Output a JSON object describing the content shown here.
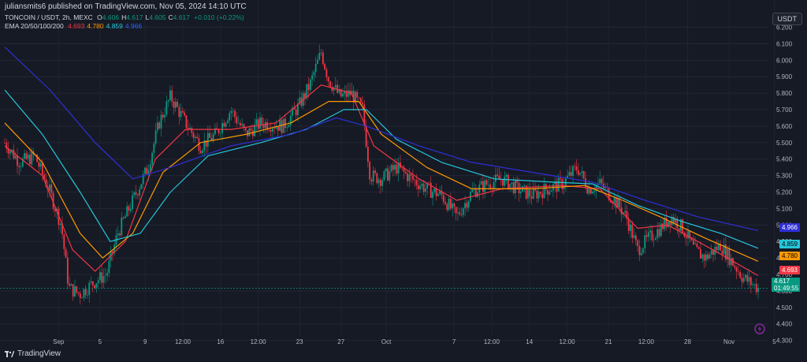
{
  "header": {
    "publish_line": "juliansmits6 published on TradingView.com, Nov 05, 2024 14:10 UTC"
  },
  "legend": {
    "symbol_text": "TONCOIN / USDT, 2h, MEXC",
    "ohlc": [
      {
        "k": "O",
        "v": "4.606"
      },
      {
        "k": "H",
        "v": "4.617"
      },
      {
        "k": "L",
        "v": "4.605"
      },
      {
        "k": "C",
        "v": "4.617"
      }
    ],
    "change": "+0.010 (+0.22%)",
    "ema_label": "EMA 20/50/100/200",
    "ema_values": [
      {
        "v": "4.693",
        "color": "#f23645"
      },
      {
        "v": "4.780",
        "color": "#ff9800"
      },
      {
        "v": "4.859",
        "color": "#26c6da"
      },
      {
        "v": "4.966",
        "color": "#2962ff"
      }
    ]
  },
  "quote_currency": "USDT",
  "price_tags": {
    "ema200": {
      "text": "4.966",
      "color": "#2f2fd4"
    },
    "ema100": {
      "text": "4.859",
      "color": "#26c6da"
    },
    "ema50": {
      "text": "4.780",
      "color": "#ff9800"
    },
    "ema20": {
      "text": "4.693",
      "color": "#f23645"
    },
    "last": {
      "text": "4.617",
      "color": "#089981"
    },
    "countdown": "01:49:55"
  },
  "brand": "TradingView",
  "chart_data": {
    "type": "candlestick",
    "ylim": [
      4.26,
      6.26
    ],
    "y_ticks": [
      "6.200",
      "6.100",
      "6.000",
      "5.900",
      "5.800",
      "5.700",
      "5.600",
      "5.500",
      "5.400",
      "5.300",
      "5.200",
      "5.100",
      "5.000",
      "4.900",
      "4.800",
      "4.700",
      "4.600",
      "4.500",
      "4.400",
      "4.300"
    ],
    "x_ticks": [
      {
        "label": "Sep",
        "t": 0.04
      },
      {
        "label": "5",
        "t": 0.095
      },
      {
        "label": "9",
        "t": 0.155
      },
      {
        "label": "12:00",
        "t": 0.205
      },
      {
        "label": "16",
        "t": 0.255
      },
      {
        "label": "12:00",
        "t": 0.305
      },
      {
        "label": "23",
        "t": 0.36
      },
      {
        "label": "27",
        "t": 0.415
      },
      {
        "label": "Oct",
        "t": 0.475
      },
      {
        "label": "7",
        "t": 0.565
      },
      {
        "label": "12:00",
        "t": 0.615
      },
      {
        "label": "14",
        "t": 0.665
      },
      {
        "label": "12:00",
        "t": 0.715
      },
      {
        "label": "21",
        "t": 0.77
      },
      {
        "label": "12:00",
        "t": 0.82
      },
      {
        "label": "28",
        "t": 0.875
      },
      {
        "label": "Nov",
        "t": 0.93
      },
      {
        "label": "5",
        "t": 0.99
      }
    ],
    "price_path": [
      {
        "t": 0.0,
        "p": 5.5
      },
      {
        "t": 0.02,
        "p": 5.38
      },
      {
        "t": 0.04,
        "p": 5.42
      },
      {
        "t": 0.06,
        "p": 5.2
      },
      {
        "t": 0.075,
        "p": 5.0
      },
      {
        "t": 0.085,
        "p": 4.62
      },
      {
        "t": 0.1,
        "p": 4.58
      },
      {
        "t": 0.12,
        "p": 4.66
      },
      {
        "t": 0.135,
        "p": 4.7
      },
      {
        "t": 0.15,
        "p": 4.95
      },
      {
        "t": 0.17,
        "p": 5.15
      },
      {
        "t": 0.19,
        "p": 5.35
      },
      {
        "t": 0.205,
        "p": 5.62
      },
      {
        "t": 0.22,
        "p": 5.78
      },
      {
        "t": 0.24,
        "p": 5.62
      },
      {
        "t": 0.26,
        "p": 5.48
      },
      {
        "t": 0.28,
        "p": 5.55
      },
      {
        "t": 0.3,
        "p": 5.7
      },
      {
        "t": 0.32,
        "p": 5.55
      },
      {
        "t": 0.34,
        "p": 5.62
      },
      {
        "t": 0.37,
        "p": 5.6
      },
      {
        "t": 0.39,
        "p": 5.72
      },
      {
        "t": 0.405,
        "p": 5.85
      },
      {
        "t": 0.42,
        "p": 6.05
      },
      {
        "t": 0.43,
        "p": 5.88
      },
      {
        "t": 0.445,
        "p": 5.78
      },
      {
        "t": 0.46,
        "p": 5.8
      },
      {
        "t": 0.475,
        "p": 5.7
      },
      {
        "t": 0.485,
        "p": 5.3
      },
      {
        "t": 0.5,
        "p": 5.28
      },
      {
        "t": 0.52,
        "p": 5.35
      },
      {
        "t": 0.54,
        "p": 5.28
      },
      {
        "t": 0.56,
        "p": 5.22
      },
      {
        "t": 0.58,
        "p": 5.18
      },
      {
        "t": 0.6,
        "p": 5.05
      },
      {
        "t": 0.62,
        "p": 5.2
      },
      {
        "t": 0.64,
        "p": 5.25
      },
      {
        "t": 0.66,
        "p": 5.28
      },
      {
        "t": 0.68,
        "p": 5.22
      },
      {
        "t": 0.7,
        "p": 5.18
      },
      {
        "t": 0.72,
        "p": 5.22
      },
      {
        "t": 0.74,
        "p": 5.25
      },
      {
        "t": 0.76,
        "p": 5.35
      },
      {
        "t": 0.775,
        "p": 5.22
      },
      {
        "t": 0.79,
        "p": 5.25
      },
      {
        "t": 0.81,
        "p": 5.15
      },
      {
        "t": 0.825,
        "p": 5.05
      },
      {
        "t": 0.84,
        "p": 4.85
      },
      {
        "t": 0.855,
        "p": 4.92
      },
      {
        "t": 0.87,
        "p": 4.98
      },
      {
        "t": 0.885,
        "p": 5.05
      },
      {
        "t": 0.9,
        "p": 4.98
      },
      {
        "t": 0.915,
        "p": 4.85
      },
      {
        "t": 0.93,
        "p": 4.8
      },
      {
        "t": 0.95,
        "p": 4.88
      },
      {
        "t": 0.965,
        "p": 4.78
      },
      {
        "t": 0.98,
        "p": 4.68
      },
      {
        "t": 1.0,
        "p": 4.617
      }
    ],
    "ema_lines": [
      {
        "name": "EMA 20",
        "color": "#f23645",
        "points": [
          {
            "t": 0.0,
            "p": 5.48
          },
          {
            "t": 0.05,
            "p": 5.3
          },
          {
            "t": 0.09,
            "p": 4.85
          },
          {
            "t": 0.12,
            "p": 4.72
          },
          {
            "t": 0.16,
            "p": 4.9
          },
          {
            "t": 0.2,
            "p": 5.4
          },
          {
            "t": 0.24,
            "p": 5.58
          },
          {
            "t": 0.3,
            "p": 5.58
          },
          {
            "t": 0.36,
            "p": 5.62
          },
          {
            "t": 0.42,
            "p": 5.85
          },
          {
            "t": 0.46,
            "p": 5.8
          },
          {
            "t": 0.49,
            "p": 5.48
          },
          {
            "t": 0.55,
            "p": 5.28
          },
          {
            "t": 0.6,
            "p": 5.15
          },
          {
            "t": 0.66,
            "p": 5.22
          },
          {
            "t": 0.74,
            "p": 5.24
          },
          {
            "t": 0.79,
            "p": 5.22
          },
          {
            "t": 0.84,
            "p": 4.98
          },
          {
            "t": 0.88,
            "p": 5.0
          },
          {
            "t": 0.94,
            "p": 4.85
          },
          {
            "t": 1.0,
            "p": 4.693
          }
        ]
      },
      {
        "name": "EMA 50",
        "color": "#ff9800",
        "points": [
          {
            "t": 0.0,
            "p": 5.62
          },
          {
            "t": 0.05,
            "p": 5.38
          },
          {
            "t": 0.1,
            "p": 4.95
          },
          {
            "t": 0.13,
            "p": 4.8
          },
          {
            "t": 0.17,
            "p": 4.95
          },
          {
            "t": 0.21,
            "p": 5.32
          },
          {
            "t": 0.26,
            "p": 5.5
          },
          {
            "t": 0.32,
            "p": 5.55
          },
          {
            "t": 0.38,
            "p": 5.62
          },
          {
            "t": 0.43,
            "p": 5.75
          },
          {
            "t": 0.47,
            "p": 5.75
          },
          {
            "t": 0.5,
            "p": 5.55
          },
          {
            "t": 0.56,
            "p": 5.35
          },
          {
            "t": 0.62,
            "p": 5.22
          },
          {
            "t": 0.7,
            "p": 5.22
          },
          {
            "t": 0.77,
            "p": 5.24
          },
          {
            "t": 0.82,
            "p": 5.15
          },
          {
            "t": 0.87,
            "p": 5.05
          },
          {
            "t": 0.93,
            "p": 4.92
          },
          {
            "t": 1.0,
            "p": 4.78
          }
        ]
      },
      {
        "name": "EMA 100",
        "color": "#26c6da",
        "points": [
          {
            "t": 0.0,
            "p": 5.82
          },
          {
            "t": 0.05,
            "p": 5.55
          },
          {
            "t": 0.1,
            "p": 5.2
          },
          {
            "t": 0.14,
            "p": 4.9
          },
          {
            "t": 0.18,
            "p": 4.95
          },
          {
            "t": 0.22,
            "p": 5.2
          },
          {
            "t": 0.27,
            "p": 5.42
          },
          {
            "t": 0.34,
            "p": 5.5
          },
          {
            "t": 0.4,
            "p": 5.58
          },
          {
            "t": 0.45,
            "p": 5.7
          },
          {
            "t": 0.48,
            "p": 5.7
          },
          {
            "t": 0.52,
            "p": 5.52
          },
          {
            "t": 0.58,
            "p": 5.38
          },
          {
            "t": 0.65,
            "p": 5.28
          },
          {
            "t": 0.73,
            "p": 5.26
          },
          {
            "t": 0.78,
            "p": 5.25
          },
          {
            "t": 0.84,
            "p": 5.12
          },
          {
            "t": 0.9,
            "p": 5.02
          },
          {
            "t": 0.95,
            "p": 4.95
          },
          {
            "t": 1.0,
            "p": 4.859
          }
        ]
      },
      {
        "name": "EMA 200",
        "color": "#2f2fd4",
        "points": [
          {
            "t": 0.0,
            "p": 6.08
          },
          {
            "t": 0.06,
            "p": 5.82
          },
          {
            "t": 0.12,
            "p": 5.5
          },
          {
            "t": 0.17,
            "p": 5.28
          },
          {
            "t": 0.22,
            "p": 5.35
          },
          {
            "t": 0.3,
            "p": 5.48
          },
          {
            "t": 0.38,
            "p": 5.55
          },
          {
            "t": 0.44,
            "p": 5.65
          },
          {
            "t": 0.48,
            "p": 5.6
          },
          {
            "t": 0.55,
            "p": 5.48
          },
          {
            "t": 0.62,
            "p": 5.38
          },
          {
            "t": 0.7,
            "p": 5.32
          },
          {
            "t": 0.78,
            "p": 5.26
          },
          {
            "t": 0.85,
            "p": 5.15
          },
          {
            "t": 0.92,
            "p": 5.05
          },
          {
            "t": 1.0,
            "p": 4.966
          }
        ]
      }
    ],
    "last_price": 4.617,
    "grid": true
  }
}
